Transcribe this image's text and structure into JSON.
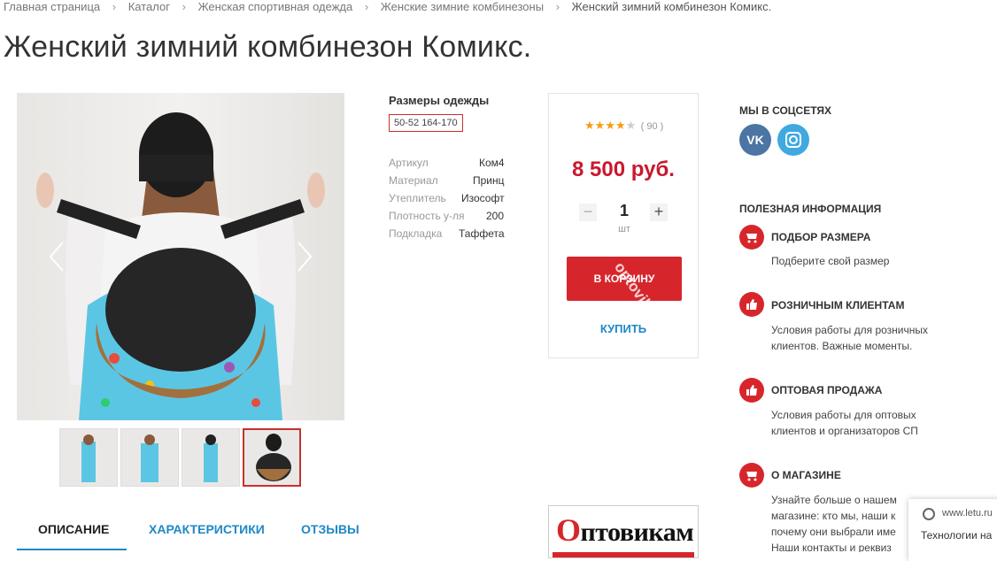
{
  "breadcrumb": {
    "items": [
      "Главная страница",
      "Каталог",
      "Женская спортивная одежда",
      "Женские зимние комбинезоны"
    ],
    "current": "Женский зимний комбинезон Комикс.",
    "separator": "›"
  },
  "product": {
    "title": "Женский зимний комбинезон Комикс.",
    "sizes_title": "Размеры одежды",
    "size_selected": "50-52 164-170",
    "specs": [
      {
        "label": "Артикул",
        "value": "Ком4"
      },
      {
        "label": "Материал",
        "value": "Принц"
      },
      {
        "label": "Утеплитель",
        "value": "Изософт"
      },
      {
        "label": "Плотность у-ля",
        "value": "200"
      },
      {
        "label": "Подкладка",
        "value": "Таффета"
      }
    ],
    "thumbnail_count": 4,
    "active_thumbnail": 4
  },
  "buy_box": {
    "rating_stars": 4,
    "rating_max": 5,
    "rating_count": "( 90 )",
    "price": "8 500 руб.",
    "quantity": "1",
    "unit": "шт",
    "minus_label": "−",
    "plus_label": "+",
    "add_to_cart_label": "В КОРЗИНУ",
    "watermark": "optovik.ru",
    "buy_label": "КУПИТЬ"
  },
  "sidebar": {
    "social_title": "МЫ В СОЦСЕТЯХ",
    "social": [
      {
        "name": "vk-icon",
        "label": "VK"
      },
      {
        "name": "instagram-icon",
        "label": ""
      }
    ],
    "info_title": "ПОЛЕЗНАЯ ИНФОРМАЦИЯ",
    "items": [
      {
        "icon": "cart-icon",
        "title": "ПОДБОР РАЗМЕРА",
        "text": "Подберите свой размер"
      },
      {
        "icon": "thumbs-up-icon",
        "title": "РОЗНИЧНЫМ КЛИЕНТАМ",
        "text": "Условия работы для розничных клиентов. Важные моменты."
      },
      {
        "icon": "thumbs-up-icon",
        "title": "ОПТОВАЯ ПРОДАЖА",
        "text": "Условия работы для оптовых клиентов и организаторов СП"
      },
      {
        "icon": "cart-icon",
        "title": "О МАГАЗИНЕ",
        "text": "Узнайте больше о нашем магазине: кто мы, наши к почему они выбрали име Наши контакты и реквиз"
      }
    ]
  },
  "tabs": [
    {
      "label": "ОПИСАНИЕ",
      "active": true
    },
    {
      "label": "ХАРАКТЕРИСТИКИ",
      "active": false
    },
    {
      "label": "ОТЗЫВЫ",
      "active": false
    }
  ],
  "banner": {
    "first_letter": "О",
    "rest": "птовикам"
  },
  "popup": {
    "url": "www.letu.ru",
    "text": "Технологии на"
  },
  "colors": {
    "accent": "#d6262c",
    "link": "#1e88c7",
    "price": "#c9182f",
    "star": "#f39c12"
  }
}
